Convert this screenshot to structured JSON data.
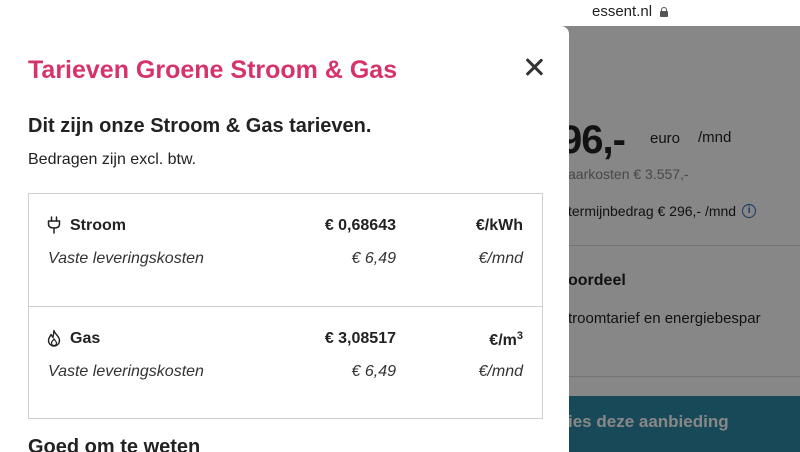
{
  "browser": {
    "url": "essent.nl"
  },
  "background": {
    "price": "96,-",
    "euro": "euro",
    "per_month": "/mnd",
    "year_costs": "aarkosten € 3.557,-",
    "term_amount": "termijnbedrag € 296,- /mnd",
    "voordeel_title": "oordeel",
    "voordeel_desc": "troomtarief en energiebespar",
    "cta_label": "ies deze aanbieding"
  },
  "modal": {
    "title": "Tarieven Groene Stroom & Gas",
    "subtitle": "Dit zijn onze Stroom & Gas tarieven.",
    "note": "Bedragen zijn excl. btw.",
    "rows": [
      {
        "icon": "plug-icon",
        "name": "Stroom",
        "price": "€ 0,68643",
        "unit": "€/kWh",
        "fixed_label": "Vaste leveringskosten",
        "fixed_price": "€ 6,49",
        "fixed_unit": "€/mnd"
      },
      {
        "icon": "flame-icon",
        "name": "Gas",
        "price": "€ 3,08517",
        "unit": "€/m",
        "unit_sup": "3",
        "fixed_label": "Vaste leveringskosten",
        "fixed_price": "€ 6,49",
        "fixed_unit": "€/mnd"
      }
    ],
    "next_section": "Goed om te weten"
  },
  "colors": {
    "title": "#d6336c",
    "cta": "#2f8ba6",
    "info": "#2a6fb6"
  }
}
